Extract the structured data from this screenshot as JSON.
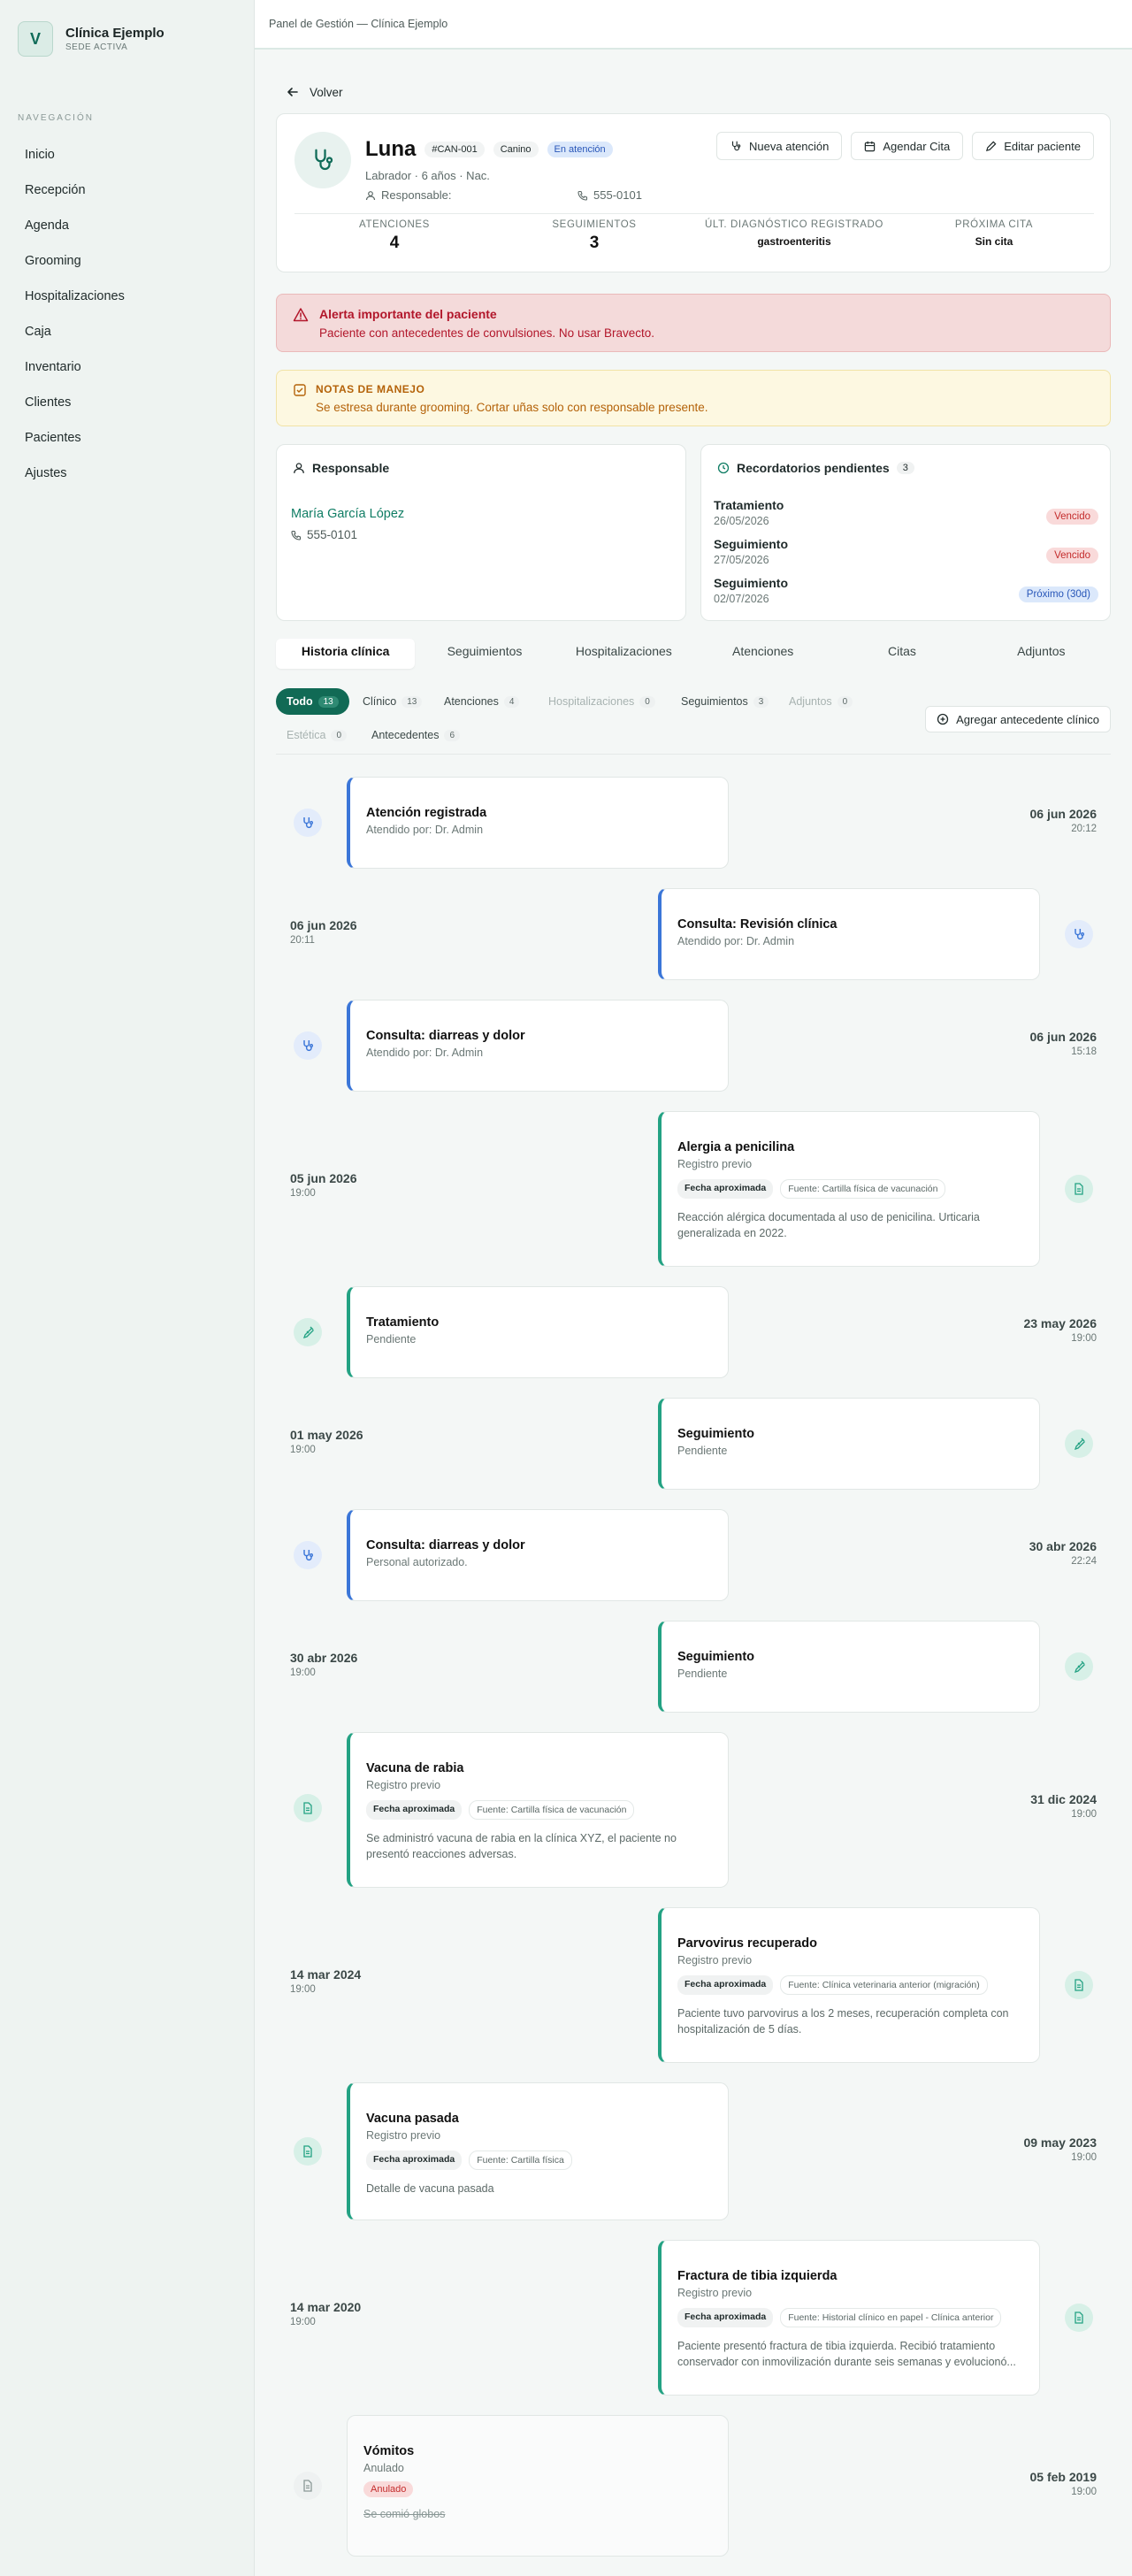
{
  "brand": {
    "initial": "V",
    "name": "Clínica Ejemplo",
    "sub": "SEDE ACTIVA"
  },
  "sidebar": {
    "heading": "NAVEGACIÓN",
    "items": [
      {
        "label": "Inicio"
      },
      {
        "label": "Recepción"
      },
      {
        "label": "Agenda"
      },
      {
        "label": "Grooming"
      },
      {
        "label": "Hospitalizaciones"
      },
      {
        "label": "Caja"
      },
      {
        "label": "Inventario"
      },
      {
        "label": "Clientes"
      },
      {
        "label": "Pacientes"
      },
      {
        "label": "Ajustes"
      }
    ]
  },
  "topbar": {
    "breadcrumb": "Panel de Gestión — Clínica Ejemplo"
  },
  "back_label": "Volver",
  "patient": {
    "name": "Luna",
    "code": "#CAN-001",
    "species": "Canino",
    "status": "En atención",
    "subtitle": "Labrador · 6 años · Nac.",
    "responsible_label": "Responsable:",
    "phone": "555-0101",
    "buttons": {
      "new_attention": "Nueva atención",
      "schedule": "Agendar Cita",
      "edit": "Editar paciente"
    },
    "stats": [
      {
        "label": "ATENCIONES",
        "value": "4"
      },
      {
        "label": "SEGUIMIENTOS",
        "value": "3"
      },
      {
        "label": "ÚLT. DIAGNÓSTICO REGISTRADO",
        "value": "gastroenteritis"
      },
      {
        "label": "PRÓXIMA CITA",
        "value": "Sin cita"
      }
    ]
  },
  "alert": {
    "title": "Alerta importante del paciente",
    "text": "Paciente con antecedentes de convulsiones. No usar Bravecto."
  },
  "notes": {
    "title": "NOTAS DE MANEJO",
    "text": "Se estresa durante grooming. Cortar uñas solo con responsable presente."
  },
  "responsable": {
    "title": "Responsable",
    "name": "María García López",
    "phone": "555-0101"
  },
  "reminders": {
    "title": "Recordatorios pendientes",
    "count": "3",
    "items": [
      {
        "name": "Tratamiento",
        "date": "26/05/2026",
        "tag": "Vencido"
      },
      {
        "name": "Seguimiento",
        "date": "27/05/2026",
        "tag": "Vencido"
      },
      {
        "name": "Seguimiento",
        "date": "02/07/2026",
        "tag": "Próximo (30d)"
      }
    ]
  },
  "tabs": [
    {
      "label": "Historia clínica"
    },
    {
      "label": "Seguimientos"
    },
    {
      "label": "Hospitalizaciones"
    },
    {
      "label": "Atenciones"
    },
    {
      "label": "Citas"
    },
    {
      "label": "Adjuntos"
    }
  ],
  "filters": [
    {
      "label": "Todo",
      "count": "13"
    },
    {
      "label": "Clínico",
      "count": "13"
    },
    {
      "label": "Atenciones",
      "count": "4"
    },
    {
      "label": "Hospitalizaciones",
      "count": "0"
    },
    {
      "label": "Seguimientos",
      "count": "3"
    },
    {
      "label": "Adjuntos",
      "count": "0"
    },
    {
      "label": "Estética",
      "count": "0"
    },
    {
      "label": "Antecedentes",
      "count": "6"
    }
  ],
  "add_button": "Agregar antecedente clínico",
  "timeline": [
    {
      "title": "Atención registrada",
      "sub": "Atendido por: Dr. Admin",
      "date": "06 jun 2026",
      "time": "20:12"
    },
    {
      "title": "Consulta: Revisión clínica",
      "sub": "Atendido por: Dr. Admin",
      "date": "06 jun 2026",
      "time": "20:11"
    },
    {
      "title": "Consulta: diarreas y dolor",
      "sub": "Atendido por: Dr. Admin",
      "date": "06 jun 2026",
      "time": "15:18"
    },
    {
      "title": "Alergia a penicilina",
      "sub": "Registro previo",
      "b1": "Fecha aproximada",
      "b2": "Fuente: Cartilla física de vacunación",
      "detail": "Reacción alérgica documentada al uso de penicilina. Urticaria generalizada en 2022.",
      "date": "05 jun 2026",
      "time": "19:00"
    },
    {
      "title": "Tratamiento",
      "sub": "Pendiente",
      "date": "23 may 2026",
      "time": "19:00"
    },
    {
      "title": "Seguimiento",
      "sub": "Pendiente",
      "date": "01 may 2026",
      "time": "19:00"
    },
    {
      "title": "Consulta: diarreas y dolor",
      "sub": "Personal autorizado.",
      "date": "30 abr 2026",
      "time": "22:24"
    },
    {
      "title": "Seguimiento",
      "sub": "Pendiente",
      "date": "30 abr 2026",
      "time": "19:00"
    },
    {
      "title": "Vacuna de rabia",
      "sub": "Registro previo",
      "b1": "Fecha aproximada",
      "b2": "Fuente: Cartilla física de vacunación",
      "detail": "Se administró vacuna de rabia en la clínica XYZ, el paciente no presentó reacciones adversas.",
      "date": "31 dic 2024",
      "time": "19:00"
    },
    {
      "title": "Parvovirus recuperado",
      "sub": "Registro previo",
      "b1": "Fecha aproximada",
      "b2": "Fuente: Clínica veterinaria anterior (migración)",
      "detail": "Paciente tuvo parvovirus a los 2 meses, recuperación completa con hospitalización de 5 días.",
      "date": "14 mar 2024",
      "time": "19:00"
    },
    {
      "title": "Vacuna pasada",
      "sub": "Registro previo",
      "b1": "Fecha aproximada",
      "b2": "Fuente: Cartilla física",
      "detail": "Detalle de vacuna pasada",
      "date": "09 may 2023",
      "time": "19:00"
    },
    {
      "title": "Fractura de tibia izquierda",
      "sub": "Registro previo",
      "b1": "Fecha aproximada",
      "b2": "Fuente: Historial clínico en papel - Clínica anterior",
      "detail": "Paciente presentó fractura de tibia izquierda. Recibió tratamiento conservador con inmovilización durante seis semanas y evolucionó...",
      "date": "14 mar 2020",
      "time": "19:00"
    },
    {
      "title": "Vómitos",
      "sub": "Anulado",
      "annul": "Anulado",
      "struck": "Se comió globos",
      "date": "05 feb 2019",
      "time": "19:00"
    }
  ],
  "colors": {
    "accent": "#116a55",
    "blue": "#3b76d8",
    "green": "#23a283",
    "alert": "#b2172b",
    "warning": "#b46209"
  }
}
